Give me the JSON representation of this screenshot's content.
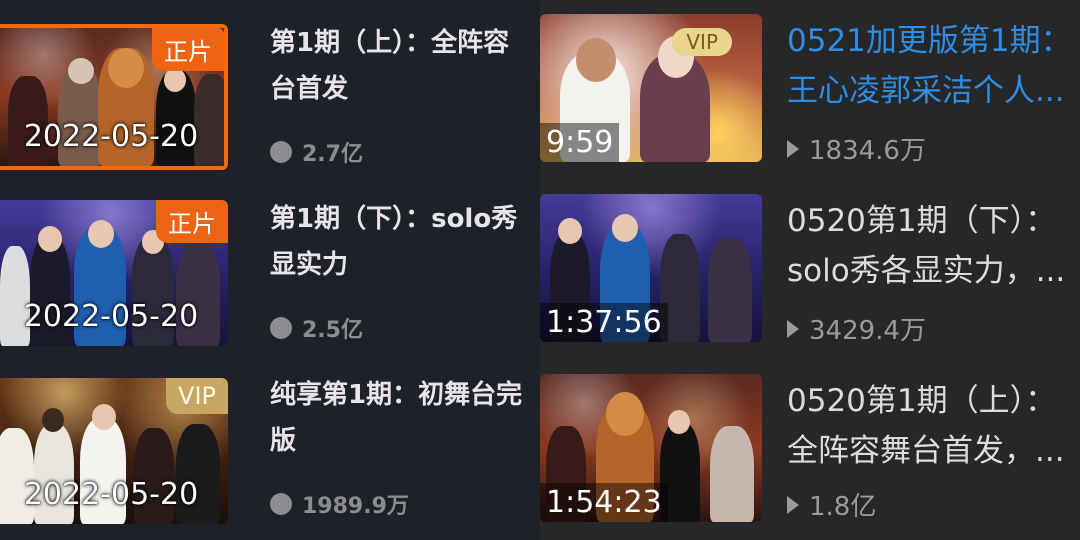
{
  "left_list": [
    {
      "title_line1": "第1期（上）：全阵容",
      "title_line2": "台首发",
      "badge": "正片",
      "date": "2022-05-20",
      "views": "2.7亿",
      "active": true
    },
    {
      "title_line1": "第1期（下）：solo秀",
      "title_line2": "显实力",
      "badge": "正片",
      "date": "2022-05-20",
      "views": "2.5亿",
      "active": false
    },
    {
      "title_line1": "纯享第1期：初舞台完",
      "title_line2": "版",
      "badge": "VIP",
      "date": "2022-05-20",
      "views": "1989.9万",
      "active": false
    }
  ],
  "right_list": [
    {
      "title_line1": "0521加更版第1期：",
      "title_line2": "王心凌郭采洁个人...",
      "badge": "VIP",
      "duration": "9:59",
      "views": "1834.6万",
      "active": true
    },
    {
      "title_line1": "0520第1期（下）：",
      "title_line2": "solo秀各显实力，...",
      "badge": "",
      "duration": "1:37:56",
      "views": "3429.4万",
      "active": false
    },
    {
      "title_line1": "0520第1期（上）：",
      "title_line2": "全阵容舞台首发，...",
      "badge": "",
      "duration": "1:54:23",
      "views": "1.8亿",
      "active": false
    }
  ],
  "colors": {
    "left_bg": "#1f2129",
    "right_bg": "#262729",
    "accent_orange": "#ef6414",
    "accent_blue": "#2f8de4",
    "vip_gold": "#c8a764"
  }
}
